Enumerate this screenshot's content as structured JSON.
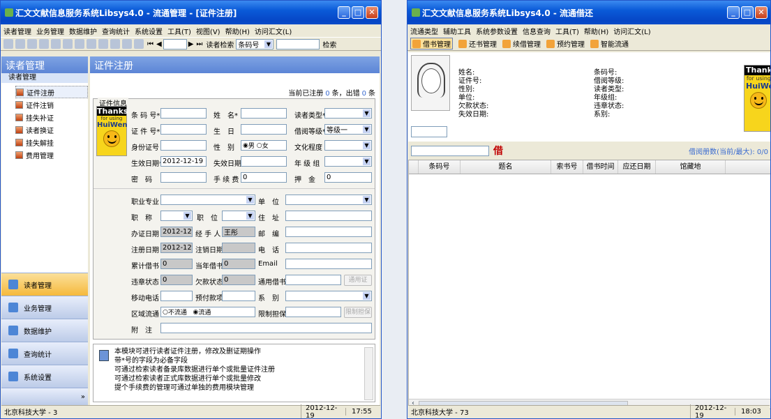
{
  "w1": {
    "title": "汇文文献信息服务系统Libsys4.0 - 流通管理 - [证件注册]",
    "menu": [
      "读者管理",
      "业务管理",
      "数据维护",
      "查询统计",
      "系统设置",
      "工具(T)",
      "视图(V)",
      "帮助(H)",
      "访问汇文(L)"
    ],
    "toolbar": {
      "search_label": "读者检索",
      "search_field": "条码号",
      "search_btn": "检索"
    },
    "left": {
      "header": "读者管理",
      "sub": "读者管理",
      "tree": [
        "证件注册",
        "证件注销",
        "挂失补证",
        "读者换证",
        "挂失解挂",
        "费用管理"
      ],
      "nav": [
        "读者管理",
        "业务管理",
        "数据维护",
        "查询统计",
        "系统设置"
      ]
    },
    "right": {
      "header": "证件注册",
      "count_pre": "当前已注册",
      "count_reg": "0",
      "count_mid": "条，出错",
      "count_err": "0",
      "count_post": "条",
      "legend": "证件信息",
      "logo": {
        "t1": "Thanks",
        "t2": "for using",
        "t3": "HuiWen"
      },
      "labels": {
        "barcode": "条 码 号*",
        "name": "姓　名*",
        "reader_type": "读者类型*",
        "cert_no": "证 件 号*",
        "birthday": "生　日",
        "borrow_level": "借阅等级*",
        "id_card": "身份证号",
        "gender": "性　别",
        "culture": "文化程度",
        "valid_date": "生效日期*",
        "expire_date": "失效日期*",
        "grade": "年 级 组",
        "password": "密　码",
        "fee": "手 续 费",
        "deposit": "押　金",
        "occupation": "职业专业",
        "unit": "单　位",
        "title": "职　称",
        "position": "职　位",
        "address": "住　址",
        "issue_date": "办证日期",
        "handler": "经 手 人",
        "postcode": "邮　编",
        "reg_date": "注册日期",
        "cancel_date": "注销日期",
        "phone": "电　话",
        "total_borrow": "累计借书",
        "year_borrow": "当年借书",
        "email": "Email",
        "violation": "违章状态",
        "debt": "欠款状态",
        "general_card": "通用借书证",
        "mobile": "移动电话",
        "prepay": "预付款项",
        "dept": "系　别",
        "region": "区域流通",
        "limited": "限制担保",
        "note": "附　注"
      },
      "values": {
        "borrow_level": "等级一",
        "gender_m": "男",
        "gender_f": "女",
        "valid_date": "2012-12-19",
        "fee": "0",
        "deposit": "0",
        "issue_date": "2012-12-19",
        "handler": "王彤",
        "reg_date": "2012-12-19",
        "total_borrow": "0",
        "year_borrow": "0",
        "violation": "0",
        "debt": "0",
        "region_no": "不流通",
        "region_yes": "流通"
      },
      "buttons": {
        "general": "通用证",
        "limited": "限制担保"
      },
      "help": [
        "本模块可进行读者证件注册，修改及删证期操作",
        "带*号的字段为必备字段",
        "可通过检索读者备录库数据进行单个或批量证件注册",
        "可通过检索读者正式库数据进行单个或批量修改",
        "提个手续费的管理可通过单独的费用模块管理"
      ]
    },
    "status": {
      "org": "北京科技大学 - 3",
      "date": "2012-12-19",
      "time": "17:55"
    }
  },
  "w2": {
    "title": "汇文文献信息服务系统Libsys4.0 - 流通借还",
    "menu": [
      "流通类型",
      "辅助工具",
      "系统参数设置",
      "信息查询",
      "工具(T)",
      "帮助(H)",
      "访问汇文(L)"
    ],
    "tools": [
      "借书管理",
      "还书管理",
      "续借管理",
      "预约管理",
      "智能流通"
    ],
    "info_left": [
      "姓名:",
      "证件号:",
      "性别:",
      "单位:",
      "欠款状态:",
      "失效日期:"
    ],
    "info_right": [
      "条码号:",
      "借阅等级:",
      "读者类型:",
      "年级组:",
      "违章状态:",
      "系别:"
    ],
    "logo": {
      "t1": "Thanks",
      "t2": "for using",
      "t3": "HuiWen"
    },
    "borrow_char": "借",
    "borrow_info": "借阅册数(当前/最大): 0/0",
    "columns": [
      "条码号",
      "题名",
      "索书号",
      "借书时间",
      "应还日期",
      "馆藏地"
    ],
    "status": {
      "org": "北京科技大学 - 73",
      "date": "2012-12-19",
      "time": "18:03"
    }
  }
}
